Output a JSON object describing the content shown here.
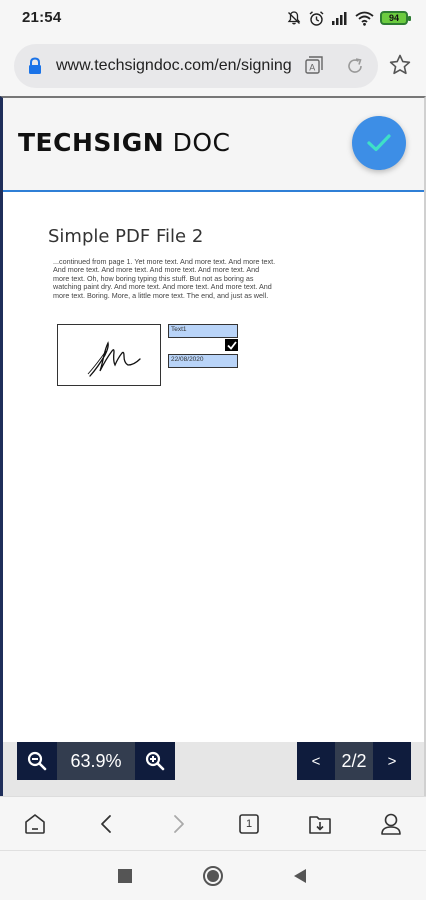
{
  "status_bar": {
    "time": "21:54",
    "battery": "94"
  },
  "browser": {
    "url": "www.techsigndoc.com/en/signing",
    "icons": [
      "lock-icon",
      "translate-icon",
      "reload-icon",
      "star-icon"
    ]
  },
  "app": {
    "logo_bold": "TECHSIGN",
    "logo_light": " DOC",
    "confirm_icon": "checkmark-icon",
    "accent_color": "#3d8ee6",
    "header_border_color": "#2f7fd6"
  },
  "document": {
    "title": "Simple PDF File 2",
    "body": "...continued from page 1. Yet more text. And more text. And more text. And more text. And more text. And more text. And more text. And more text. Oh, how boring typing this stuff. But not as boring as watching paint dry. And more text. And more text. And more text. And more text. Boring.  More, a little more text. The end, and just as well.",
    "text_field_label": "Text1",
    "date_field_value": "22/08/2020",
    "field_color": "#b9d4f8"
  },
  "controls": {
    "zoom_level": "63.9%",
    "zoom_out_icon": "zoom-out-icon",
    "zoom_in_icon": "zoom-in-icon",
    "prev_label": "<",
    "page_indicator": "2/2",
    "next_label": ">",
    "control_color": "#0f1c3d"
  },
  "browser_nav": {
    "items": [
      "home-icon",
      "back-icon",
      "forward-icon",
      "tabs-icon",
      "downloads-icon",
      "profile-icon"
    ],
    "tab_count": "1"
  },
  "system_nav": {
    "items": [
      "recents-icon",
      "home-circle-icon",
      "back-triangle-icon"
    ]
  }
}
